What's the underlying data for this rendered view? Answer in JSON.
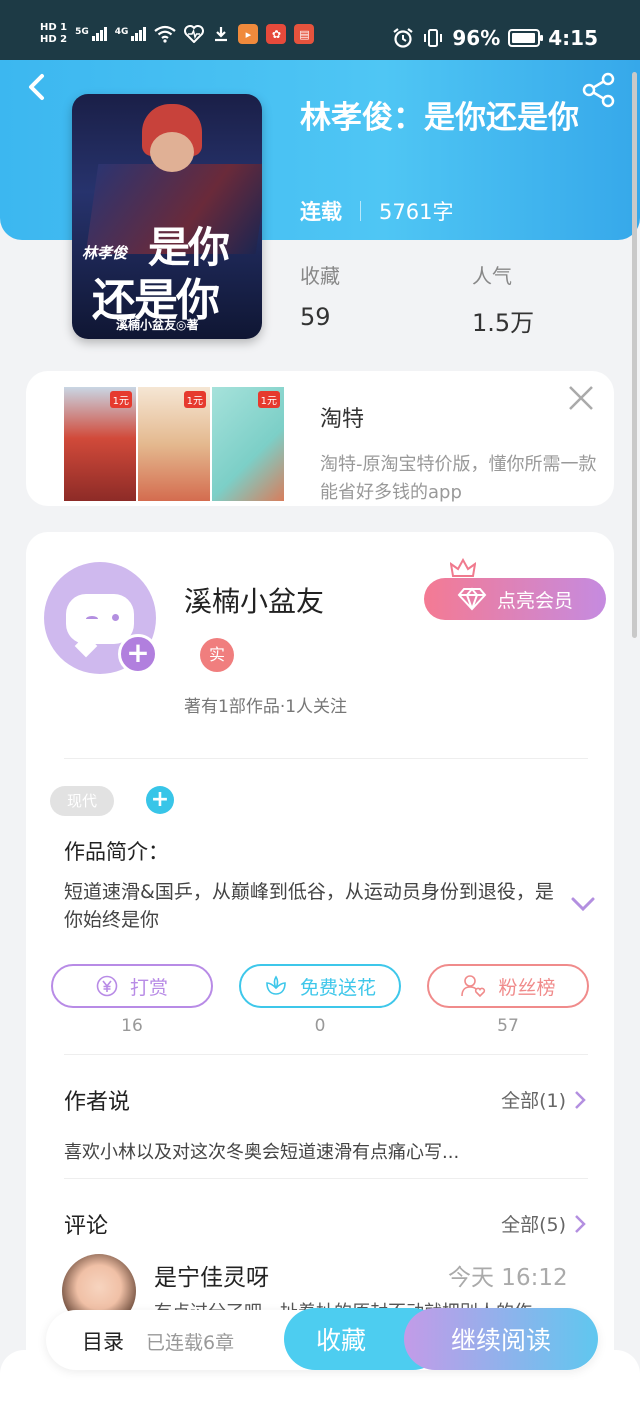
{
  "status_bar": {
    "hd1": "HD 1",
    "hd2": "HD 2",
    "sig1": "5G",
    "sig2": "4G",
    "battery_pct": "96%",
    "time": "4:15",
    "colors": {
      "bg": "#1d3a45",
      "tile_orange": "#f08a3c",
      "tile_red": "#e64a3b",
      "tile_red2": "#e5533d"
    }
  },
  "book": {
    "title": "林孝俊：是你还是你",
    "status": "连载",
    "word_count": "5761字",
    "stats": [
      {
        "label": "收藏",
        "value": "59"
      },
      {
        "label": "人气",
        "value": "1.5万"
      }
    ],
    "cover": {
      "line1": "林孝俊",
      "line2": "是你",
      "line3": "还是你",
      "credit": "溪楠小盆友◎著"
    },
    "header_color": "#3cb7f0"
  },
  "ad": {
    "title": "淘特",
    "description": "淘特-原淘宝特价版，懂你所需一款能省好多钱的app",
    "price_tag": "1元"
  },
  "author": {
    "name": "溪楠小盆友",
    "vip_label": "点亮会员",
    "badge": "实",
    "stats": "著有1部作品·1人关注"
  },
  "tags": {
    "genre": "现代",
    "add_label": "+"
  },
  "intro": {
    "title": "作品简介：",
    "text": "短道速滑&国乒，从巅峰到低谷，从运动员身份到退役，是你始终是你"
  },
  "actions": [
    {
      "label": "打赏",
      "count": "16",
      "color": "#b88be6",
      "icon": "yen-icon"
    },
    {
      "label": "免费送花",
      "count": "0",
      "color": "#3ec7ea",
      "icon": "flower-icon"
    },
    {
      "label": "粉丝榜",
      "count": "57",
      "color": "#f08b8b",
      "icon": "fans-icon"
    }
  ],
  "author_says": {
    "title": "作者说",
    "more": "全部(1)",
    "text": "喜欢小林以及对这次冬奥会短道速滑有点痛心写..."
  },
  "comments": {
    "title": "评论",
    "more": "全部(5)",
    "items": [
      {
        "user": "是宁佳灵呀",
        "time": "今天 16:12",
        "text": "冇点过分了吧，扯着扯的原封不动就把别人的作"
      }
    ]
  },
  "bottom": {
    "toc": "目录",
    "chapters": "已连载6章",
    "favorite": "收藏",
    "continue": "继续阅读"
  }
}
